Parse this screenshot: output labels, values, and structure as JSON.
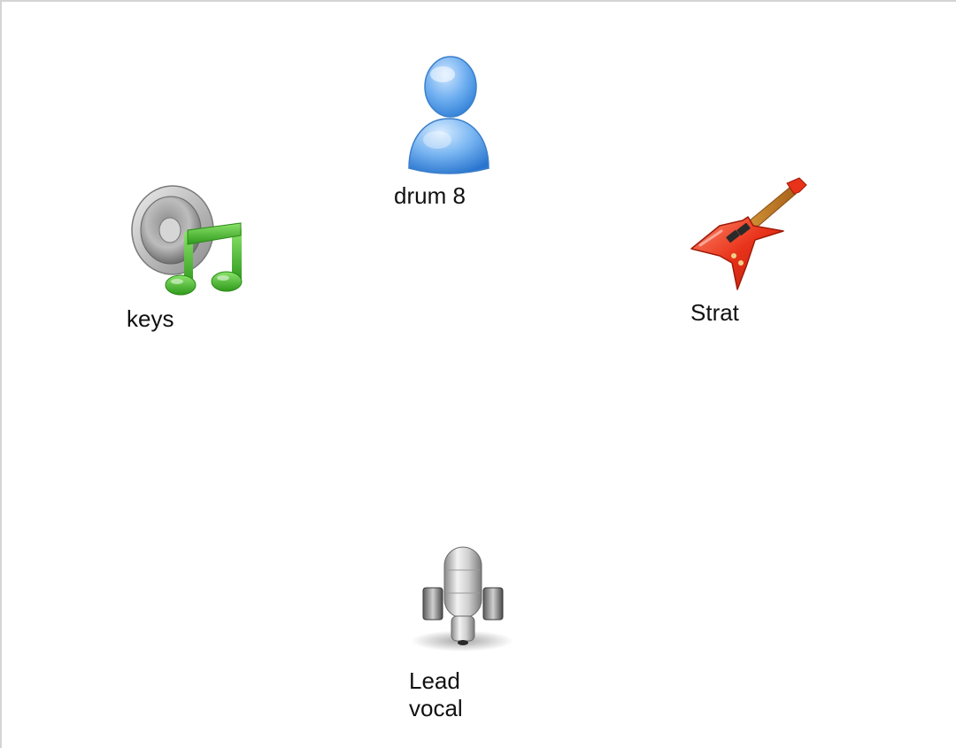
{
  "canvas": {
    "nodes": [
      {
        "id": "drum",
        "label": "drum 8",
        "icon": "person-icon"
      },
      {
        "id": "keys",
        "label": "keys",
        "icon": "speaker-music-note-icon"
      },
      {
        "id": "strat",
        "label": "Strat",
        "icon": "electric-guitar-icon"
      },
      {
        "id": "vocal",
        "label": "Lead vocal",
        "icon": "microphone-icon"
      }
    ]
  },
  "colors": {
    "border": "#d4d4d4",
    "person_blue": "#5aa0e8",
    "note_green": "#3fae2a",
    "guitar_red": "#e8321a"
  }
}
